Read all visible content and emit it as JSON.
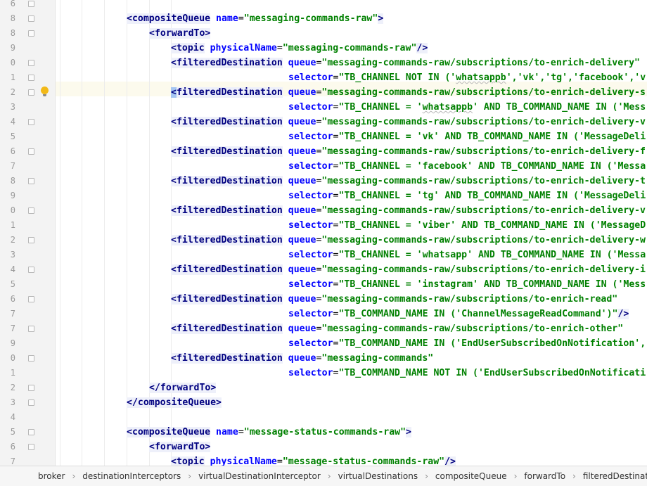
{
  "lines": [
    {
      "num": "6",
      "indent": 0,
      "fold": true,
      "parts": []
    },
    {
      "num": "8",
      "indent": 1,
      "fold": true,
      "parts": [
        [
          "tag",
          "<compositeQueue"
        ],
        [
          "p",
          " "
        ],
        [
          "attr",
          "name"
        ],
        [
          "p",
          "="
        ],
        [
          "val",
          "\"messaging-commands-raw\""
        ],
        [
          "tag",
          ">"
        ]
      ]
    },
    {
      "num": "8",
      "indent": 2,
      "fold": true,
      "parts": [
        [
          "tag",
          "<forwardTo"
        ],
        [
          "tag",
          ">"
        ]
      ]
    },
    {
      "num": "9",
      "indent": 3,
      "fold": false,
      "parts": [
        [
          "tag",
          "<topic"
        ],
        [
          "p",
          " "
        ],
        [
          "attr",
          "physicalName"
        ],
        [
          "p",
          "="
        ],
        [
          "val",
          "\"messaging-commands-raw\""
        ],
        [
          "tag",
          "/>"
        ]
      ]
    },
    {
      "num": "0",
      "indent": 3,
      "fold": true,
      "parts": [
        [
          "tag",
          "<filteredDestination"
        ],
        [
          "p",
          " "
        ],
        [
          "attr",
          "queue"
        ],
        [
          "p",
          "="
        ],
        [
          "val",
          "\"messaging-commands-raw/subscriptions/to-enrich-delivery\""
        ]
      ]
    },
    {
      "num": "1",
      "indent": 4,
      "fold": true,
      "parts": [
        [
          "attr",
          "selector"
        ],
        [
          "p",
          "="
        ],
        [
          "val",
          "\"TB_CHANNEL NOT IN ('"
        ],
        [
          "vals",
          "whatsappb"
        ],
        [
          "val",
          "','vk','tg','facebook','v"
        ]
      ]
    },
    {
      "num": "2",
      "indent": 3,
      "fold": true,
      "bulb": true,
      "caret": true,
      "parts": [
        [
          "caret",
          "<"
        ],
        [
          "tag",
          "filteredDestination"
        ],
        [
          "p",
          " "
        ],
        [
          "attr",
          "queue"
        ],
        [
          "p",
          "="
        ],
        [
          "val",
          "\"messaging-commands-raw/subscriptions/to-enrich-delivery-s"
        ]
      ]
    },
    {
      "num": "3",
      "indent": 4,
      "fold": false,
      "parts": [
        [
          "attr",
          "selector"
        ],
        [
          "p",
          "="
        ],
        [
          "val",
          "\"TB_CHANNEL = '"
        ],
        [
          "vals",
          "whatsappb"
        ],
        [
          "val",
          "' AND TB_COMMAND_NAME IN ('Mess"
        ]
      ]
    },
    {
      "num": "4",
      "indent": 3,
      "fold": true,
      "parts": [
        [
          "tag",
          "<filteredDestination"
        ],
        [
          "p",
          " "
        ],
        [
          "attr",
          "queue"
        ],
        [
          "p",
          "="
        ],
        [
          "val",
          "\"messaging-commands-raw/subscriptions/to-enrich-delivery-v"
        ]
      ]
    },
    {
      "num": "5",
      "indent": 4,
      "fold": false,
      "parts": [
        [
          "attr",
          "selector"
        ],
        [
          "p",
          "="
        ],
        [
          "val",
          "\"TB_CHANNEL = 'vk' AND TB_COMMAND_NAME IN ('MessageDeli"
        ]
      ]
    },
    {
      "num": "6",
      "indent": 3,
      "fold": true,
      "parts": [
        [
          "tag",
          "<filteredDestination"
        ],
        [
          "p",
          " "
        ],
        [
          "attr",
          "queue"
        ],
        [
          "p",
          "="
        ],
        [
          "val",
          "\"messaging-commands-raw/subscriptions/to-enrich-delivery-f"
        ]
      ]
    },
    {
      "num": "7",
      "indent": 4,
      "fold": false,
      "parts": [
        [
          "attr",
          "selector"
        ],
        [
          "p",
          "="
        ],
        [
          "val",
          "\"TB_CHANNEL = 'facebook' AND TB_COMMAND_NAME IN ('Messa"
        ]
      ]
    },
    {
      "num": "8",
      "indent": 3,
      "fold": true,
      "parts": [
        [
          "tag",
          "<filteredDestination"
        ],
        [
          "p",
          " "
        ],
        [
          "attr",
          "queue"
        ],
        [
          "p",
          "="
        ],
        [
          "val",
          "\"messaging-commands-raw/subscriptions/to-enrich-delivery-t"
        ]
      ]
    },
    {
      "num": "9",
      "indent": 4,
      "fold": false,
      "parts": [
        [
          "attr",
          "selector"
        ],
        [
          "p",
          "="
        ],
        [
          "val",
          "\"TB_CHANNEL = 'tg' AND TB_COMMAND_NAME IN ('MessageDeli"
        ]
      ]
    },
    {
      "num": "0",
      "indent": 3,
      "fold": true,
      "parts": [
        [
          "tag",
          "<filteredDestination"
        ],
        [
          "p",
          " "
        ],
        [
          "attr",
          "queue"
        ],
        [
          "p",
          "="
        ],
        [
          "val",
          "\"messaging-commands-raw/subscriptions/to-enrich-delivery-v"
        ]
      ]
    },
    {
      "num": "1",
      "indent": 4,
      "fold": false,
      "parts": [
        [
          "attr",
          "selector"
        ],
        [
          "p",
          "="
        ],
        [
          "val",
          "\"TB_CHANNEL = 'viber' AND TB_COMMAND_NAME IN ('MessageD"
        ]
      ]
    },
    {
      "num": "2",
      "indent": 3,
      "fold": true,
      "parts": [
        [
          "tag",
          "<filteredDestination"
        ],
        [
          "p",
          " "
        ],
        [
          "attr",
          "queue"
        ],
        [
          "p",
          "="
        ],
        [
          "val",
          "\"messaging-commands-raw/subscriptions/to-enrich-delivery-w"
        ]
      ]
    },
    {
      "num": "3",
      "indent": 4,
      "fold": false,
      "parts": [
        [
          "attr",
          "selector"
        ],
        [
          "p",
          "="
        ],
        [
          "val",
          "\"TB_CHANNEL = 'whatsapp' AND TB_COMMAND_NAME IN ('Messa"
        ]
      ]
    },
    {
      "num": "4",
      "indent": 3,
      "fold": true,
      "parts": [
        [
          "tag",
          "<filteredDestination"
        ],
        [
          "p",
          " "
        ],
        [
          "attr",
          "queue"
        ],
        [
          "p",
          "="
        ],
        [
          "val",
          "\"messaging-commands-raw/subscriptions/to-enrich-delivery-i"
        ]
      ]
    },
    {
      "num": "5",
      "indent": 4,
      "fold": false,
      "parts": [
        [
          "attr",
          "selector"
        ],
        [
          "p",
          "="
        ],
        [
          "val",
          "\"TB_CHANNEL = 'instagram' AND TB_COMMAND_NAME IN ('Mess"
        ]
      ]
    },
    {
      "num": "6",
      "indent": 3,
      "fold": true,
      "parts": [
        [
          "tag",
          "<filteredDestination"
        ],
        [
          "p",
          " "
        ],
        [
          "attr",
          "queue"
        ],
        [
          "p",
          "="
        ],
        [
          "val",
          "\"messaging-commands-raw/subscriptions/to-enrich-read\""
        ]
      ]
    },
    {
      "num": "7",
      "indent": 4,
      "fold": false,
      "parts": [
        [
          "attr",
          "selector"
        ],
        [
          "p",
          "="
        ],
        [
          "val",
          "\"TB_COMMAND_NAME IN ('ChannelMessageReadCommand')\""
        ],
        [
          "tag",
          "/>"
        ]
      ]
    },
    {
      "num": "7",
      "indent": 3,
      "fold": true,
      "parts": [
        [
          "tag",
          "<filteredDestination"
        ],
        [
          "p",
          " "
        ],
        [
          "attr",
          "queue"
        ],
        [
          "p",
          "="
        ],
        [
          "val",
          "\"messaging-commands-raw/subscriptions/to-enrich-other\""
        ]
      ]
    },
    {
      "num": "9",
      "indent": 4,
      "fold": false,
      "parts": [
        [
          "attr",
          "selector"
        ],
        [
          "p",
          "="
        ],
        [
          "val",
          "\"TB_COMMAND_NAME IN ('EndUserSubscribedOnNotification',"
        ]
      ]
    },
    {
      "num": "0",
      "indent": 3,
      "fold": true,
      "parts": [
        [
          "tag",
          "<filteredDestination"
        ],
        [
          "p",
          " "
        ],
        [
          "attr",
          "queue"
        ],
        [
          "p",
          "="
        ],
        [
          "val",
          "\"messaging-commands\""
        ]
      ]
    },
    {
      "num": "1",
      "indent": 4,
      "fold": false,
      "parts": [
        [
          "attr",
          "selector"
        ],
        [
          "p",
          "="
        ],
        [
          "val",
          "\"TB_COMMAND_NAME NOT IN ('EndUserSubscribedOnNotificati"
        ]
      ]
    },
    {
      "num": "2",
      "indent": 2,
      "fold": true,
      "parts": [
        [
          "tag",
          "</forwardTo"
        ],
        [
          "tag",
          ">"
        ]
      ]
    },
    {
      "num": "3",
      "indent": 1,
      "fold": true,
      "parts": [
        [
          "tag",
          "</compositeQueue"
        ],
        [
          "tag",
          ">"
        ]
      ]
    },
    {
      "num": "4",
      "indent": 0,
      "fold": false,
      "parts": []
    },
    {
      "num": "5",
      "indent": 1,
      "fold": true,
      "parts": [
        [
          "tag",
          "<compositeQueue"
        ],
        [
          "p",
          " "
        ],
        [
          "attr",
          "name"
        ],
        [
          "p",
          "="
        ],
        [
          "val",
          "\"message-status-commands-raw\""
        ],
        [
          "tag",
          ">"
        ]
      ]
    },
    {
      "num": "6",
      "indent": 2,
      "fold": true,
      "parts": [
        [
          "tag",
          "<forwardTo"
        ],
        [
          "tag",
          ">"
        ]
      ]
    },
    {
      "num": "7",
      "indent": 3,
      "fold": false,
      "parts": [
        [
          "tag",
          "<topic"
        ],
        [
          "p",
          " "
        ],
        [
          "attr",
          "physicalName"
        ],
        [
          "p",
          "="
        ],
        [
          "val",
          "\"message-status-commands-raw\""
        ],
        [
          "tag",
          "/>"
        ]
      ]
    }
  ],
  "breadcrumb": [
    "broker",
    "destinationInterceptors",
    "virtualDestinationInterceptor",
    "virtualDestinations",
    "compositeQueue",
    "forwardTo",
    "filteredDestination"
  ],
  "icons": {
    "intention": "lightbulb-icon",
    "fold": "fold-marker-icon",
    "separator": "chevron-right-icon"
  },
  "colors": {
    "tag": "#000080",
    "attribute": "#0000ff",
    "value": "#008000",
    "tag_bg": "#eef0fa",
    "caret_line": "#fcfaed",
    "bulb": "#f2b918"
  }
}
